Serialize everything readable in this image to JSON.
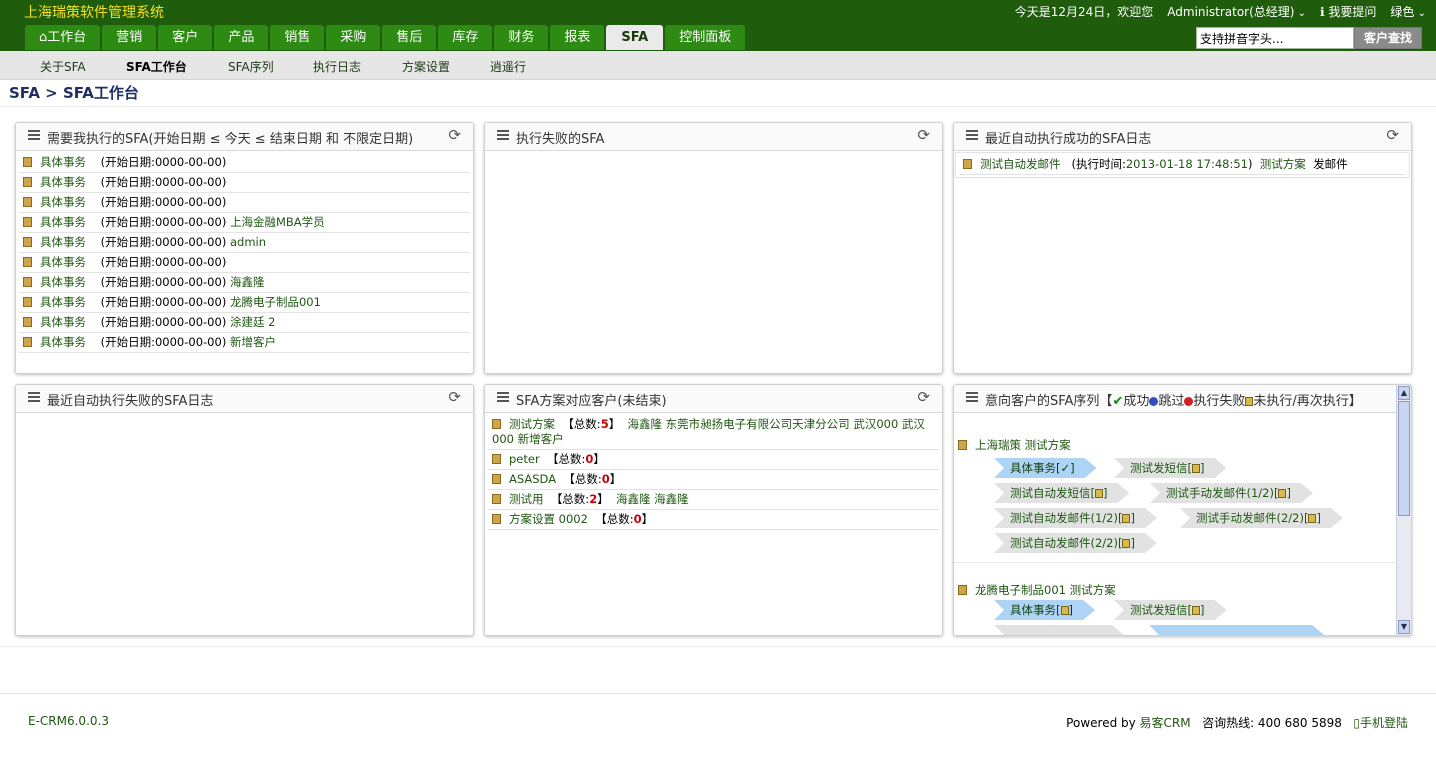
{
  "app_title": "上海瑞策软件管理系统",
  "topbar": {
    "greeting": "今天是12月24日，欢迎您",
    "user": "Administrator(总经理)",
    "help": "我要提问",
    "theme": "绿色"
  },
  "nav": {
    "tabs": [
      "工作台",
      "营销",
      "客户",
      "产品",
      "销售",
      "采购",
      "售后",
      "库存",
      "财务",
      "报表",
      "SFA",
      "控制面板"
    ],
    "active": "SFA"
  },
  "search": {
    "placeholder": "支持拼音字头...",
    "button": "客户查找"
  },
  "subnav": [
    "关于SFA",
    "SFA工作台",
    "SFA序列",
    "执行日志",
    "方案设置",
    "逍遥行"
  ],
  "breadcrumb": "SFA > SFA工作台",
  "panels": {
    "p1": {
      "title": "需要我执行的SFA(开始日期 ≤ 今天 ≤ 结束日期 和 不限定日期)",
      "rows": [
        {
          "task": "具体事务",
          "date": "(开始日期:0000-00-00)",
          "extra": ""
        },
        {
          "task": "具体事务",
          "date": "(开始日期:0000-00-00)",
          "extra": ""
        },
        {
          "task": "具体事务",
          "date": "(开始日期:0000-00-00)",
          "extra": ""
        },
        {
          "task": "具体事务",
          "date": "(开始日期:0000-00-00)",
          "extra": "上海金融MBA学员"
        },
        {
          "task": "具体事务",
          "date": "(开始日期:0000-00-00)",
          "extra": "admin"
        },
        {
          "task": "具体事务",
          "date": "(开始日期:0000-00-00)",
          "extra": ""
        },
        {
          "task": "具体事务",
          "date": "(开始日期:0000-00-00)",
          "extra": "海鑫隆"
        },
        {
          "task": "具体事务",
          "date": "(开始日期:0000-00-00)",
          "extra": "龙腾电子制品001"
        },
        {
          "task": "具体事务",
          "date": "(开始日期:0000-00-00)",
          "extra": "涂建廷 2"
        },
        {
          "task": "具体事务",
          "date": "(开始日期:0000-00-00)",
          "extra": "新增客户"
        }
      ]
    },
    "p2": {
      "title": "执行失败的SFA"
    },
    "p3": {
      "title": "最近自动执行成功的SFA日志",
      "row": {
        "name": "测试自动发邮件",
        "label": "(执行时间:",
        "time": "2013-01-18 17:48:51",
        "close": ")",
        "plan": "测试方案",
        "action": "发邮件"
      }
    },
    "p4": {
      "title": "最近自动执行失败的SFA日志"
    },
    "p5": {
      "title": "SFA方案对应客户(未结束)",
      "rows": [
        {
          "name": "测试方案",
          "open": "【总数:",
          "count": "5",
          "close": "】",
          "customers": "海鑫隆 东莞市昶扬电子有限公司天津分公司 武汉000 武汉000 新增客户"
        },
        {
          "name": "peter",
          "open": "【总数:",
          "count": "0",
          "close": "】",
          "customers": ""
        },
        {
          "name": "ASASDA",
          "open": "【总数:",
          "count": "0",
          "close": "】",
          "customers": ""
        },
        {
          "name": "测试用",
          "open": "【总数:",
          "count": "2",
          "close": "】",
          "customers": "海鑫隆 海鑫隆"
        },
        {
          "name": "方案设置 0002",
          "open": "【总数:",
          "count": "0",
          "close": "】",
          "customers": ""
        }
      ]
    },
    "p6": {
      "title_a": "意向客户的SFA序列【",
      "ok": "成功",
      "skip": "跳过",
      "fail": "执行失败",
      "pending": "未执行/再次执行】",
      "groups": [
        {
          "header": "上海瑞策 测试方案",
          "steps": [
            "具体事务[✓]",
            "测试发短信[",
            "测试自动发短信[",
            "测试手动发邮件(1/2)[",
            "测试自动发邮件(1/2)[",
            "测试手动发邮件(2/2)[",
            "测试自动发邮件(2/2)["
          ]
        },
        {
          "header": "龙腾电子制品001 测试方案",
          "steps": [
            "具体事务[",
            "测试发短信["
          ]
        }
      ],
      "step_close": "]"
    }
  },
  "footer": {
    "version": "E-CRM6.0.0.3",
    "powered": "Powered by ",
    "brand": "易客CRM",
    "hotline": "咨询热线: 400 680 5898",
    "mobile": "手机登陆"
  }
}
